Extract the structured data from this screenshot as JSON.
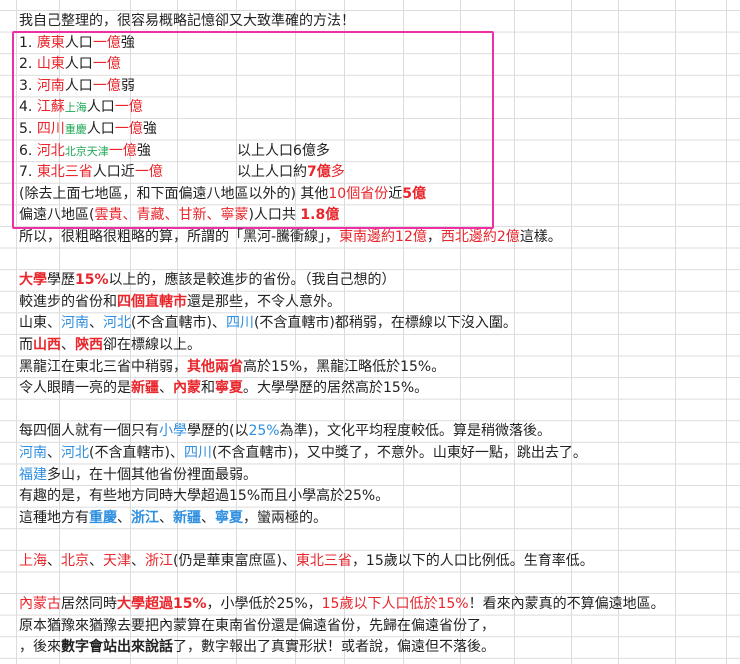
{
  "colors": {
    "red": "#e8262c",
    "green": "#1fa855",
    "blue": "#2f8fe0",
    "box": "#ee2fa5"
  },
  "lines": [
    {
      "row": 0,
      "segs": [
        [
          "我自己整理的，很容易概略記憶卻又大致準確的方法！",
          ""
        ]
      ]
    },
    {
      "row": 1,
      "segs": [
        [
          "1. ",
          ""
        ],
        [
          "廣東",
          "red"
        ],
        [
          "人口",
          ""
        ],
        [
          "一億",
          "red"
        ],
        [
          "強",
          ""
        ]
      ]
    },
    {
      "row": 2,
      "segs": [
        [
          "2. ",
          ""
        ],
        [
          "山東",
          "red"
        ],
        [
          "人口",
          ""
        ],
        [
          "一億",
          "red"
        ]
      ]
    },
    {
      "row": 3,
      "segs": [
        [
          "3. ",
          ""
        ],
        [
          "河南",
          "red"
        ],
        [
          "人口",
          ""
        ],
        [
          "一億",
          "red"
        ],
        [
          "弱",
          ""
        ]
      ]
    },
    {
      "row": 4,
      "segs": [
        [
          "4. ",
          ""
        ],
        [
          "江蘇",
          "red"
        ],
        [
          "上海",
          "green"
        ],
        [
          "人口",
          ""
        ],
        [
          "一億",
          "red"
        ]
      ]
    },
    {
      "row": 5,
      "segs": [
        [
          "5. ",
          ""
        ],
        [
          "四川",
          "red"
        ],
        [
          "重慶",
          "green"
        ],
        [
          "人口",
          ""
        ],
        [
          "一億",
          "red"
        ],
        [
          "強",
          ""
        ]
      ]
    },
    {
      "row": 6,
      "segs": [
        [
          "6. ",
          ""
        ],
        [
          "河北",
          "red"
        ],
        [
          "北京天津",
          "green"
        ],
        [
          "一億",
          "red"
        ],
        [
          "強",
          ""
        ]
      ],
      "col2": [
        [
          "以上人口6億多",
          ""
        ]
      ]
    },
    {
      "row": 7,
      "segs": [
        [
          "7. ",
          ""
        ],
        [
          "東北三省",
          "red"
        ],
        [
          "人口近",
          ""
        ],
        [
          "一億",
          "red"
        ]
      ],
      "col2": [
        [
          "以上人口約",
          ""
        ],
        [
          "7億",
          "redb"
        ],
        [
          "多",
          "red"
        ]
      ]
    },
    {
      "row": 8,
      "segs": [
        [
          "(除去上面七地區，和下面偏遠八地區以外的) 其他",
          ""
        ],
        [
          "10個省份",
          "red"
        ],
        [
          "近",
          ""
        ],
        [
          "5億",
          "redb"
        ]
      ]
    },
    {
      "row": 9,
      "segs": [
        [
          "偏遠八地區(",
          ""
        ],
        [
          "雲貴、青藏、甘新、寧蒙",
          "red"
        ],
        [
          ")人口共 ",
          ""
        ],
        [
          "1.8億",
          "redb"
        ]
      ]
    },
    {
      "row": 10,
      "segs": [
        [
          "所以，很粗略很粗略的算，所謂的「黑河-騰衝線」，",
          ""
        ],
        [
          "東南邊約12億",
          "red"
        ],
        [
          "，",
          ""
        ],
        [
          "西北邊約2億",
          "red"
        ],
        [
          "這樣。",
          ""
        ]
      ]
    },
    {
      "row": 12,
      "segs": [
        [
          "大學",
          "redb"
        ],
        [
          "學歷",
          ""
        ],
        [
          "15%",
          "redb"
        ],
        [
          "以上的，應該是較進步的省份。（我自己想的）",
          ""
        ]
      ]
    },
    {
      "row": 13,
      "segs": [
        [
          "較進步的省份和",
          ""
        ],
        [
          "四個直轄市",
          "redb"
        ],
        [
          "還是那些，不令人意外。",
          ""
        ]
      ]
    },
    {
      "row": 14,
      "segs": [
        [
          "山東、",
          ""
        ],
        [
          "河南",
          "blue"
        ],
        [
          "、",
          ""
        ],
        [
          "河北",
          "blue"
        ],
        [
          "(不含直轄市)、",
          ""
        ],
        [
          "四川",
          "blue"
        ],
        [
          "(不含直轄市)都稍弱，在標線以下沒入圍。",
          ""
        ]
      ]
    },
    {
      "row": 15,
      "segs": [
        [
          "而",
          ""
        ],
        [
          "山西",
          "redb"
        ],
        [
          "、",
          ""
        ],
        [
          "陝西",
          "redb"
        ],
        [
          "卻在標線以上。",
          ""
        ]
      ]
    },
    {
      "row": 16,
      "segs": [
        [
          "黑龍江在東北三省中稍弱，",
          ""
        ],
        [
          "其他兩省",
          "redb"
        ],
        [
          "高於15%，黑龍江略低於15%。",
          ""
        ]
      ]
    },
    {
      "row": 17,
      "segs": [
        [
          "令人眼睛一亮的是",
          ""
        ],
        [
          "新疆",
          "redb"
        ],
        [
          "、",
          ""
        ],
        [
          "內蒙",
          "redb"
        ],
        [
          "和",
          ""
        ],
        [
          "寧夏",
          "redb"
        ],
        [
          "。大學學歷的居然高於15%。",
          ""
        ]
      ]
    },
    {
      "row": 19,
      "segs": [
        [
          "每四個人就有一個只有",
          ""
        ],
        [
          "小學",
          "blue"
        ],
        [
          "學歷的(以",
          ""
        ],
        [
          "25%",
          "blue"
        ],
        [
          "為準)，文化平均程度較低。算是稍微落後。",
          ""
        ]
      ]
    },
    {
      "row": 20,
      "segs": [
        [
          "河南",
          "blue"
        ],
        [
          "、",
          ""
        ],
        [
          "河北",
          "blue"
        ],
        [
          "(不含直轄市)、",
          ""
        ],
        [
          "四川",
          "blue"
        ],
        [
          "(不含直轄市)，又中獎了，不意外。山東好一點，跳出去了。",
          ""
        ]
      ]
    },
    {
      "row": 21,
      "segs": [
        [
          "福建",
          "blue"
        ],
        [
          "多山，在十個其他省份裡面最弱。",
          ""
        ]
      ]
    },
    {
      "row": 22,
      "segs": [
        [
          "有趣的是，有些地方同時大學超過15%而且小學高於25%。",
          ""
        ]
      ]
    },
    {
      "row": 23,
      "segs": [
        [
          "這種地方有",
          ""
        ],
        [
          "重慶",
          "blueb"
        ],
        [
          "、",
          ""
        ],
        [
          "浙江",
          "blueb"
        ],
        [
          "、",
          ""
        ],
        [
          "新疆",
          "blueb"
        ],
        [
          "、",
          ""
        ],
        [
          "寧夏",
          "blueb"
        ],
        [
          "，蠻兩極的。",
          ""
        ]
      ]
    },
    {
      "row": 25,
      "segs": [
        [
          "上海",
          "red"
        ],
        [
          "、",
          ""
        ],
        [
          "北京",
          "red"
        ],
        [
          "、",
          ""
        ],
        [
          "天津",
          "red"
        ],
        [
          "、",
          ""
        ],
        [
          "浙江",
          "red"
        ],
        [
          "(仍是華東富庶區)、",
          ""
        ],
        [
          "東北三省",
          "red"
        ],
        [
          "，15歲以下的人口比例低。生育率低。",
          ""
        ]
      ]
    },
    {
      "row": 27,
      "segs": [
        [
          "內蒙古",
          "red"
        ],
        [
          "居然同時",
          ""
        ],
        [
          "大學超過15%",
          "redb"
        ],
        [
          "，小學低於25%，",
          ""
        ],
        [
          "15歲以下人口低於15%",
          "red"
        ],
        [
          "！看來內蒙真的不算偏遠地區。",
          ""
        ]
      ]
    },
    {
      "row": 28,
      "segs": [
        [
          "原本猶豫來猶豫去要把內蒙算在東南省份還是偏遠省份，先歸在偏遠省份了，",
          ""
        ]
      ]
    },
    {
      "row": 29,
      "segs": [
        [
          "，後來",
          ""
        ],
        [
          "數字會站出來說話",
          "bold"
        ],
        [
          "了，數字報出了真實形狀！或者說，偏遠但不落後。",
          ""
        ]
      ]
    }
  ]
}
